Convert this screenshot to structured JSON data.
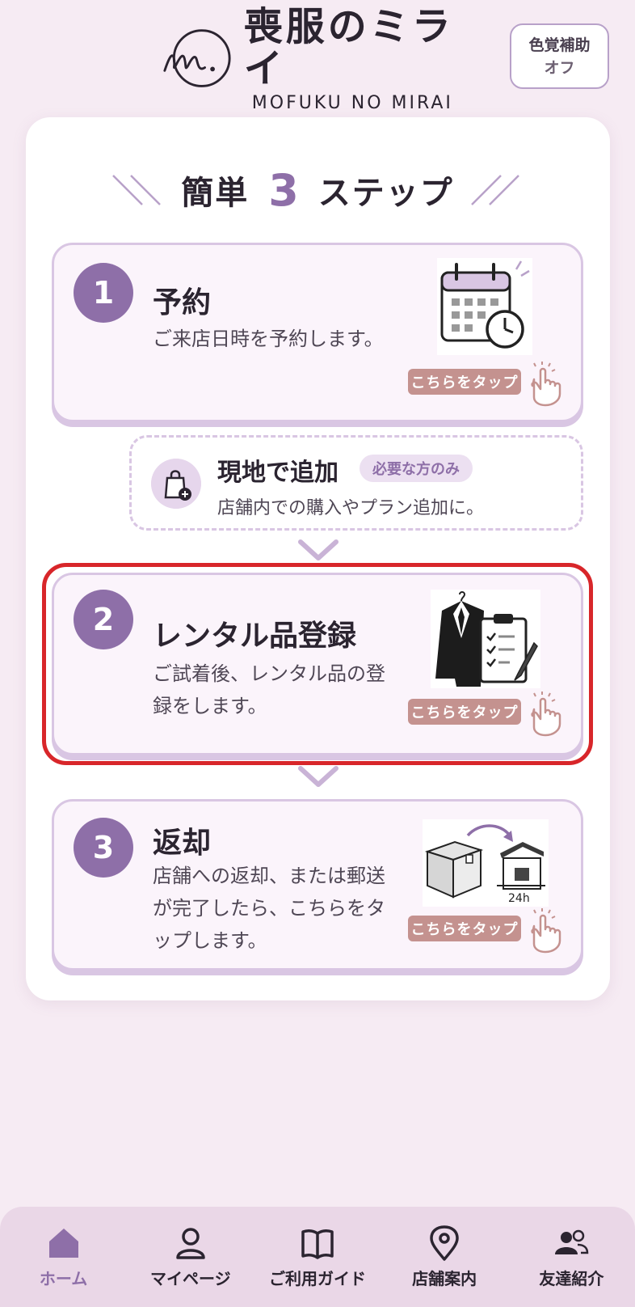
{
  "header": {
    "logo_title": "喪服のミライ",
    "logo_subtitle": "MOFUKU NO MIRAI",
    "color_assist_label": "色覚補助",
    "color_assist_state": "オフ"
  },
  "heading": {
    "prefix": "簡単",
    "number": "3",
    "suffix": "ステップ"
  },
  "steps": [
    {
      "number": "1",
      "title": "予約",
      "description": "ご来店日時を予約します。",
      "tap_label": "こちらをタップ",
      "icon": "calendar-clock-icon"
    },
    {
      "number": "2",
      "title": "レンタル品登録",
      "description": "ご試着後、レンタル品の登録をします。",
      "tap_label": "こちらをタップ",
      "icon": "suit-clipboard-icon"
    },
    {
      "number": "3",
      "title": "返却",
      "description": "店舗への返却、または郵送が完了したら、こちらをタップします。",
      "tap_label": "こちらをタップ",
      "icon": "box-return-icon"
    }
  ],
  "optional": {
    "title": "現地で追加",
    "badge": "必要な方のみ",
    "description": "店舗内での購入やプラン追加に。",
    "icon": "shopping-bag-plus-icon"
  },
  "illus_text": {
    "hours": "24h"
  },
  "nav": [
    {
      "label": "ホーム",
      "icon": "home-icon",
      "active": true
    },
    {
      "label": "マイページ",
      "icon": "user-icon",
      "active": false
    },
    {
      "label": "ご利用ガイド",
      "icon": "book-icon",
      "active": false
    },
    {
      "label": "店舗案内",
      "icon": "map-pin-icon",
      "active": false
    },
    {
      "label": "友達紹介",
      "icon": "friends-icon",
      "active": false
    }
  ],
  "colors": {
    "accent": "#8e6fa8",
    "background": "#f6ebf3",
    "tap_badge": "#c4928f",
    "highlight": "#d8262a"
  }
}
